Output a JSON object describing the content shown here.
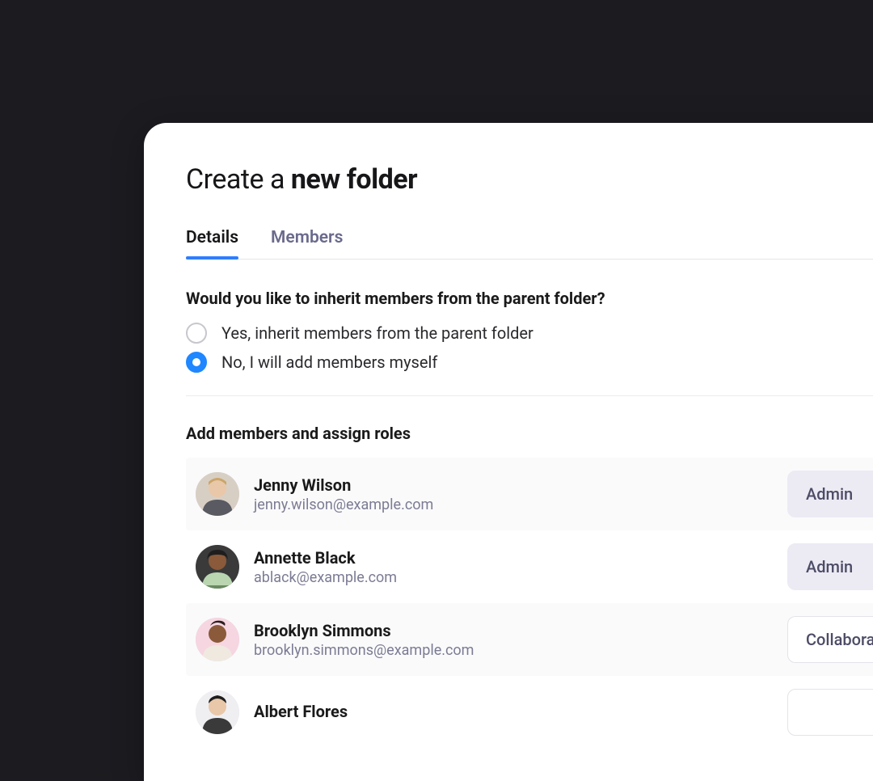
{
  "title": {
    "prefix": "Create a ",
    "bold": "new folder"
  },
  "tabs": [
    {
      "label": "Details",
      "active": true
    },
    {
      "label": "Members",
      "active": false
    }
  ],
  "inherit": {
    "question": "Would you like to inherit members from the parent folder?",
    "options": [
      {
        "label": "Yes, inherit members from the parent folder",
        "selected": false
      },
      {
        "label": "No, I will add members myself",
        "selected": true
      }
    ]
  },
  "addSection": {
    "heading": "Add members and assign roles",
    "members": [
      {
        "name": "Jenny Wilson",
        "email": "jenny.wilson@example.com",
        "role": "Admin",
        "roleFilled": true
      },
      {
        "name": "Annette Black",
        "email": "ablack@example.com",
        "role": "Admin",
        "roleFilled": true
      },
      {
        "name": "Brooklyn Simmons",
        "email": "brooklyn.simmons@example.com",
        "role": "Collaborator",
        "roleFilled": false
      },
      {
        "name": "Albert Flores",
        "email": "",
        "role": "",
        "roleFilled": false
      }
    ]
  },
  "colors": {
    "accent": "#1f87ff",
    "tabUnderline": "#2f7dff",
    "muted": "#7b7b94",
    "roleFilledBg": "#eceaf3"
  },
  "avatarDefs": [
    {
      "bg": "#d8cfc4",
      "skin": "#e9c7a9",
      "hair": "#caa66a",
      "shirt": "#5a5a62"
    },
    {
      "bg": "#3a3a3a",
      "skin": "#8a5a3a",
      "hair": "#1e1e1e",
      "shirt": "#b9d6b0"
    },
    {
      "bg": "#f6d6e1",
      "skin": "#8a5a3a",
      "hair": "#2a1e1e",
      "shirt": "#efe9e0"
    },
    {
      "bg": "#efeff2",
      "skin": "#e9c7a9",
      "hair": "#1e1e1e",
      "shirt": "#3a3a3a"
    }
  ]
}
